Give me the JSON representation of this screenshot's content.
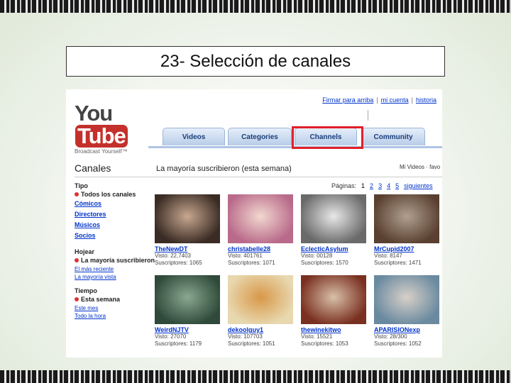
{
  "slide": {
    "title": "23- Selección de canales"
  },
  "youtube": {
    "logo_you": "You",
    "logo_tube": "Tube",
    "tagline": "Broadcast Yourself™",
    "top_links": [
      "Firmar para arriba",
      "mi cuenta",
      "historia"
    ],
    "tabs": [
      "Videos",
      "Categories",
      "Channels",
      "Community"
    ],
    "selected_tab": "Channels",
    "page_heading": "Canales",
    "list_heading": "La mayoría suscribieron (esta semana)",
    "right_link": "Mi Videos · favo",
    "pagination": {
      "label": "Páginas:",
      "pages": [
        "1",
        "2",
        "3",
        "4",
        "5"
      ],
      "current": "1",
      "next": "siguientes"
    },
    "sidebar": {
      "tipo": {
        "heading": "Tipo",
        "active": "Todos los canales",
        "links": [
          "Cómicos",
          "Directores",
          "Músicos",
          "Socios"
        ]
      },
      "hojear": {
        "heading": "Hojear",
        "active": "La mayoría suscribieron",
        "links": [
          "El más reciente",
          "La mayoría vista"
        ]
      },
      "tiempo": {
        "heading": "Tiempo",
        "active": "Esta semana",
        "links": [
          "Este mes",
          "Todo la hora"
        ]
      }
    },
    "channels": [
      {
        "name": "TheNewDT",
        "views": "Visto: 22,7403",
        "subs": "Suscriptores: 1065",
        "thumb_colors": [
          "#3a2b24",
          "#c8a890"
        ]
      },
      {
        "name": "christabelle28",
        "views": "Visto: 401761",
        "subs": "Suscriptores: 1071",
        "thumb_colors": [
          "#b96a8a",
          "#f2d8d0"
        ]
      },
      {
        "name": "EclecticAsylum",
        "views": "Visto: 00128",
        "subs": "Suscriptores: 1570",
        "thumb_colors": [
          "#6a6a6a",
          "#e8e8e8"
        ]
      },
      {
        "name": "MrCupid2007",
        "views": "Visto: 8147",
        "subs": "Suscriptores: 1471",
        "thumb_colors": [
          "#5a4030",
          "#b0a090"
        ]
      },
      {
        "name": "WeirdNJTV",
        "views": "Visto: 27070",
        "subs": "Suscriptores: 1179",
        "thumb_colors": [
          "#2f4a3a",
          "#8aa890"
        ]
      },
      {
        "name": "dekoolguy1",
        "views": "Visto: 107703",
        "subs": "Suscriptores: 1051",
        "thumb_colors": [
          "#e8d8b0",
          "#d89848"
        ]
      },
      {
        "name": "thewinekitwo",
        "views": "Visto: 15521",
        "subs": "Suscriptores: 1053",
        "thumb_colors": [
          "#7a3020",
          "#d8c0a8"
        ]
      },
      {
        "name": "APARISIONexp",
        "views": "Visto: 28/300",
        "subs": "Suscriptores: 1052",
        "thumb_colors": [
          "#6a8aa0",
          "#d8d0c8"
        ]
      }
    ],
    "colors": {
      "link": "#0033cc",
      "highlight": "#e0202a",
      "tab": "#b8cde8",
      "logo_red": "#c4302b"
    }
  }
}
